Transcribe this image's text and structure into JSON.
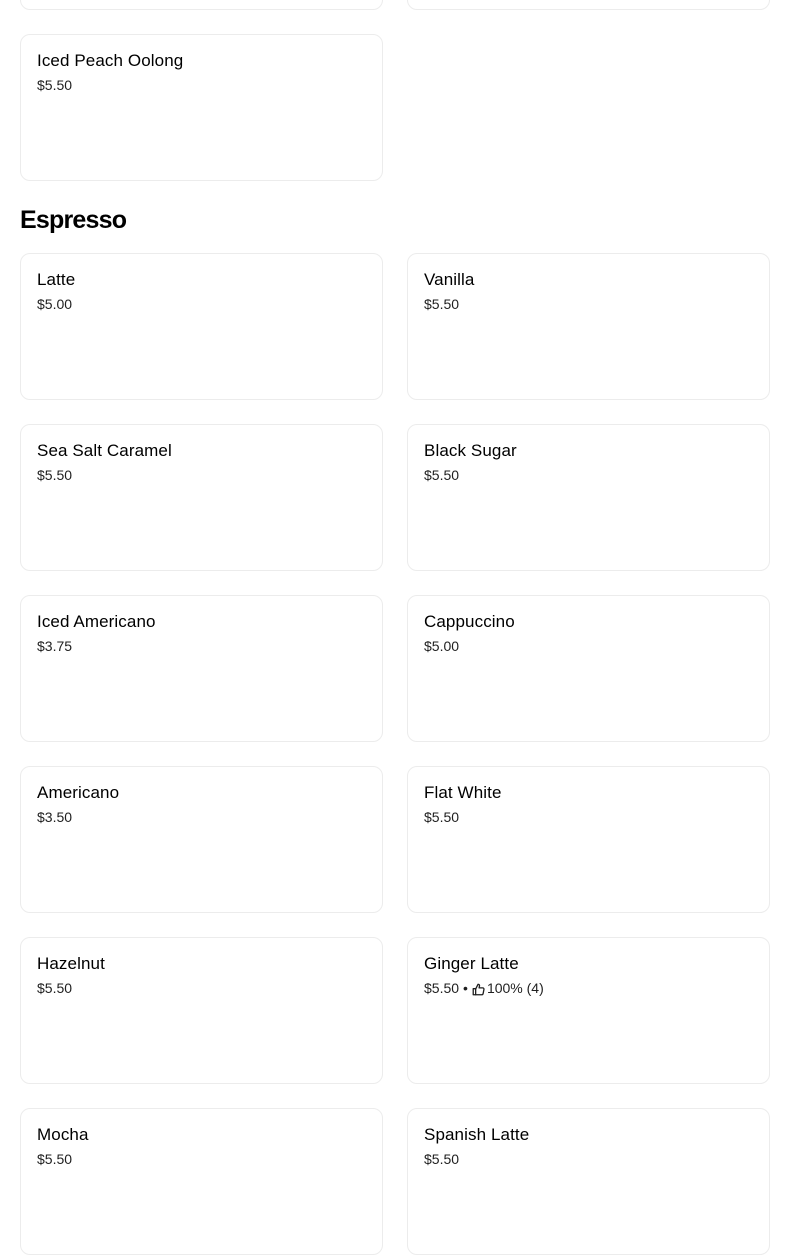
{
  "top_cards_partial": [
    {
      "name": "",
      "price": ""
    },
    {
      "name": "",
      "price": ""
    }
  ],
  "previous_section_items": [
    {
      "name": "Iced Peach Oolong",
      "price": "$5.50"
    }
  ],
  "espresso_section": {
    "title": "Espresso",
    "items": [
      {
        "name": "Latte",
        "price": "$5.00"
      },
      {
        "name": "Vanilla",
        "price": "$5.50"
      },
      {
        "name": "Sea Salt Caramel",
        "price": "$5.50"
      },
      {
        "name": "Black Sugar",
        "price": "$5.50"
      },
      {
        "name": "Iced Americano",
        "price": "$3.75"
      },
      {
        "name": "Cappuccino",
        "price": "$5.00"
      },
      {
        "name": "Americano",
        "price": "$3.50"
      },
      {
        "name": "Flat White",
        "price": "$5.50"
      },
      {
        "name": "Hazelnut",
        "price": "$5.50"
      },
      {
        "name": "Ginger Latte",
        "price": "$5.50",
        "separator": "•",
        "rating_icon": "thumbs-up-icon",
        "rating": "100% (4)"
      },
      {
        "name": "Mocha",
        "price": "$5.50"
      },
      {
        "name": "Spanish Latte",
        "price": "$5.50"
      }
    ]
  }
}
